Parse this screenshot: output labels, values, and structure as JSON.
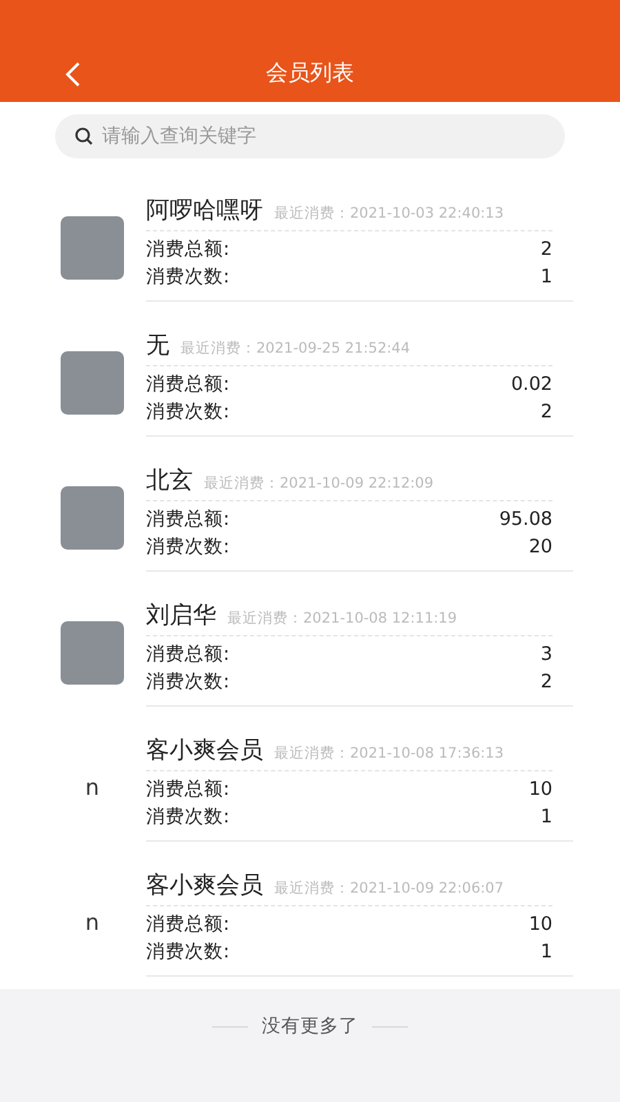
{
  "header": {
    "title": "会员列表"
  },
  "search": {
    "placeholder": "请输入查询关键字"
  },
  "members": [
    {
      "kind": "photo",
      "name": "阿啰哈嘿呀",
      "last_label": "最近消费：",
      "last_time": "2021-10-03 22:40:13",
      "total_label": "消费总额:",
      "total": "2",
      "count_label": "消费次数:",
      "count": "1"
    },
    {
      "kind": "photo",
      "name": "无",
      "last_label": "最近消费：",
      "last_time": "2021-09-25 21:52:44",
      "total_label": "消费总额:",
      "total": "0.02",
      "count_label": "消费次数:",
      "count": "2"
    },
    {
      "kind": "photo",
      "name": "北玄",
      "last_label": "最近消费：",
      "last_time": "2021-10-09 22:12:09",
      "total_label": "消费总额:",
      "total": "95.08",
      "count_label": "消费次数:",
      "count": "20"
    },
    {
      "kind": "photo",
      "name": "刘启华",
      "last_label": "最近消费：",
      "last_time": "2021-10-08 12:11:19",
      "total_label": "消费总额:",
      "total": "3",
      "count_label": "消费次数:",
      "count": "2"
    },
    {
      "kind": "text",
      "avatar_text": "n",
      "name": "客小爽会员",
      "last_label": "最近消费：",
      "last_time": "2021-10-08 17:36:13",
      "total_label": "消费总额:",
      "total": "10",
      "count_label": "消费次数:",
      "count": "1"
    },
    {
      "kind": "text",
      "avatar_text": "n",
      "name": "客小爽会员",
      "last_label": "最近消费：",
      "last_time": "2021-10-09 22:06:07",
      "total_label": "消费总额:",
      "total": "10",
      "count_label": "消费次数:",
      "count": "1"
    }
  ],
  "footer": {
    "text": "没有更多了"
  }
}
